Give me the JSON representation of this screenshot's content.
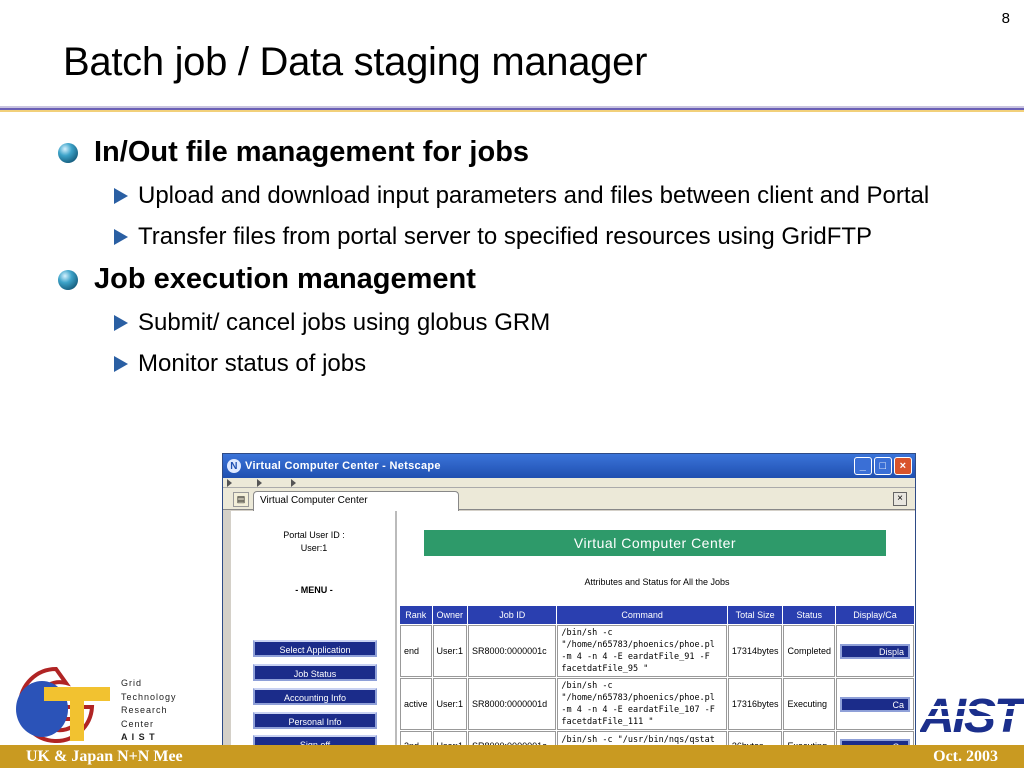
{
  "slide": {
    "number": "8",
    "title": "Batch job / Data staging manager"
  },
  "bullets": [
    {
      "text": "In/Out file management for jobs",
      "sub": [
        "Upload and download input parameters and files between client and Portal",
        "Transfer files from portal server to specified resources using GridFTP"
      ]
    },
    {
      "text": "Job execution management",
      "sub": [
        "Submit/ cancel jobs using globus GRM",
        "Monitor status of jobs"
      ]
    }
  ],
  "browser": {
    "window_title": "Virtual Computer Center - Netscape",
    "tab_label": "Virtual Computer Center",
    "portal_user_label": "Portal User ID :",
    "portal_user_value": "User:1",
    "menu_title": "- MENU -",
    "menu": [
      "Select Application",
      "Job Status",
      "Accounting Info",
      "Personal Info",
      "Sign off"
    ],
    "banner": "Virtual Computer Center",
    "subtitle": "Attributes and Status for All the Jobs",
    "table": {
      "headers": [
        "Rank",
        "Owner",
        "Job ID",
        "Command",
        "Total Size",
        "Status",
        "Display/Ca"
      ],
      "rows": [
        {
          "rank": "end",
          "owner": "User:1",
          "job_id": "SR8000:0000001c",
          "command": "/bin/sh -c \"/home/n65783/phoenics/phoe.pl -m 4 -n 4 -E eardatFile_91 -F facetdatFile_95 \"",
          "size": "17314bytes",
          "status": "Completed",
          "button": "Displa"
        },
        {
          "rank": "active",
          "owner": "User:1",
          "job_id": "SR8000:0000001d",
          "command": "/bin/sh -c \"/home/n65783/phoenics/phoe.pl -m 4 -n 4 -E eardatFile_107 -F facetdatFile_111 \"",
          "size": "17316bytes",
          "status": "Executing",
          "button": "Ca"
        },
        {
          "rank": "2nd",
          "owner": "User:1",
          "job_id": "SR8000:0000001e",
          "command": "/bin/sh -c \"/usr/bin/nqs/qstat -a \"",
          "size": "36bytes",
          "status": "Executing",
          "button": "Ca"
        }
      ]
    }
  },
  "logos": {
    "gtrc_lines": [
      "Grid",
      "Technology",
      "Research",
      "Center",
      "A I S T"
    ],
    "aist": "AIST"
  },
  "footer": {
    "left": "UK & Japan N+N Mee",
    "right": "Oct. 2003"
  },
  "colors": {
    "title_rule": "#6a5fb5",
    "bullet_triangle": "#2a5fa3",
    "banner": "#2e9a6a",
    "table_header": "#2a3fb0",
    "menu_button": "#1b2c8a",
    "footer": "#c99a21"
  }
}
